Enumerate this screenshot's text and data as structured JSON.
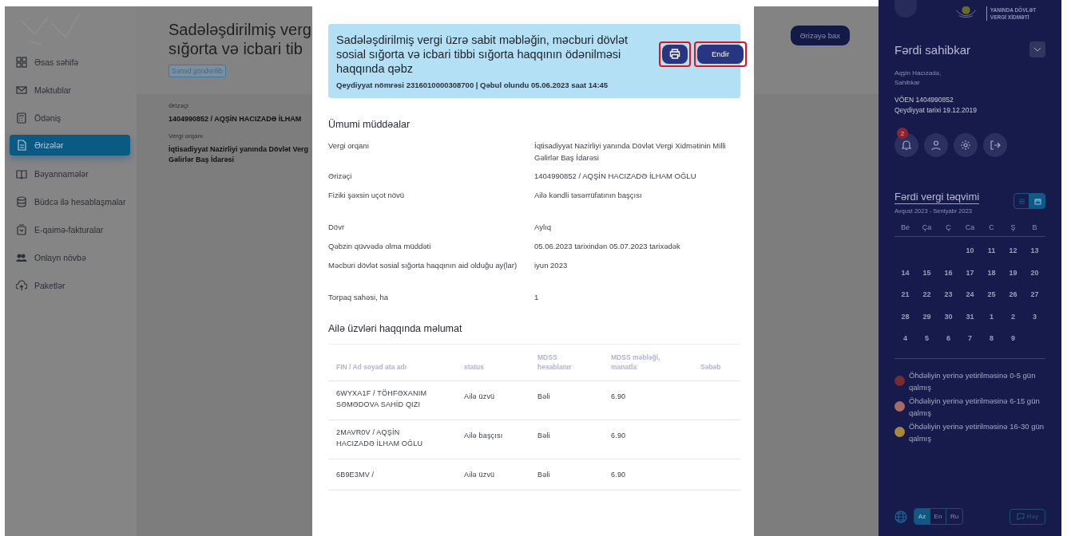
{
  "sidebar": {
    "items": [
      {
        "label": "Əsas səhifə",
        "selected": false
      },
      {
        "label": "Məktublar",
        "selected": false
      },
      {
        "label": "Ödəniş",
        "selected": false
      },
      {
        "label": "Ərizələr",
        "selected": true
      },
      {
        "label": "Bəyannamələr",
        "selected": false
      },
      {
        "label": "Büdcə ilə hesablaşmalar",
        "selected": false
      },
      {
        "label": "E-qaimə-fakturalar",
        "selected": false
      },
      {
        "label": "Onlayn növbə",
        "selected": false
      },
      {
        "label": "Paketlər",
        "selected": false
      }
    ]
  },
  "page": {
    "title_lines": [
      "Sadələşdirilmiş verg",
      "sığorta və icbari tib"
    ],
    "status_badge": "Sənəd göndərilib",
    "view_button": "Ərizəyə bax",
    "fields": [
      {
        "label": "Ərizəçi",
        "value": "1404990852 / AQŞİN HACIZADƏ İLHAM"
      },
      {
        "label": "Vergi orqanı",
        "value": "İqtisadiyyat Nazirliyi yanında Dövlət Verg Gəlirlər Baş İdarəsi"
      }
    ]
  },
  "modal": {
    "title": "Sadələşdirilmiş vergi üzrə sabit məbləğin, məcburi dövlət sosial sığorta və icbari tibbi sığorta haqqının ödənilməsi haqqında qəbz",
    "subtitle": "Qeydiyyat nömrəsi 2316010000308700 | Qəbul olundu 05.06.2023 saat 14:45",
    "print_button": {
      "highlighted": true
    },
    "download_button": {
      "label": "Endir",
      "highlighted": true
    },
    "section_title": "Ümumi müddəalar",
    "details": [
      {
        "label": "Vergi orqanı",
        "value": "İqtisadiyyat Nazirliyi yanında Dövlət Vergi Xidmətinin Milli Gəlirlər Baş İdarəsi"
      },
      {
        "label": "Ərizəçi",
        "value": "1404990852 / AQŞİN HACIZADƏ İLHAM OĞLU"
      },
      {
        "label": "Fiziki şəxsin uçot növü",
        "value": "Ailə kəndli təsərrüfatının başçısı"
      },
      {
        "label": "Dövr",
        "value": "Aylıq"
      },
      {
        "label": "Qəbzin qüvvədə olma müddəti",
        "value": "05.06.2023 tarixindən 05.07.2023 tarixədək"
      },
      {
        "label": "Məcburi dövlət sosial sığorta haqqının aid olduğu ay(lar)",
        "value": "iyun 2023"
      },
      {
        "label": "Torpaq sahəsi, ha",
        "value": "1"
      }
    ],
    "table_title": "Ailə üzvləri haqqında məlumat",
    "table": {
      "columns": [
        "FIN / Ad soyad ata adı",
        "status",
        "MDSS hesablanır",
        "MDSS məbləği, manatla",
        "Səbəb"
      ],
      "rows": [
        [
          "6WYXA1F / TÖHFƏXANIM SƏMƏDOVA SAHİD QIZI",
          "Ailə üzvü",
          "Bəli",
          "6.90"
        ],
        [
          "2MAVR0V / AQŞİN HACIZADƏ İLHAM OĞLU",
          "Ailə başçısı",
          "Bəli",
          "6.90"
        ],
        [
          "6B9E3MV /",
          "Ailə üzvü",
          "Bəli",
          "6.90"
        ]
      ]
    }
  },
  "profile": {
    "logo_text": "YANINDA DÖVLƏT VERGİ XİDMƏTİ",
    "role": "Fərdi sahibkar",
    "name_lines": [
      "Aqşin Hacızadə,",
      "Sahibkar"
    ],
    "voen": "VÖEN 1404990852",
    "registered": "Qeydiyyat tarixi 19.12.2019",
    "notification_count": "2"
  },
  "calendar": {
    "title": "Fərdi vergi təqvimi",
    "range": "Avqust 2023 - Sentyabr 2023",
    "views": [
      {
        "kind": "list",
        "selected": false
      },
      {
        "kind": "calendar",
        "selected": true
      }
    ],
    "weekdays": [
      "Be",
      "Ça",
      "Ç",
      "Ca",
      "C",
      "Ş",
      "B"
    ],
    "weeks": [
      [
        "10",
        "11",
        "12",
        "13"
      ],
      [
        "14",
        "15",
        "16",
        "17",
        "18",
        "19",
        "20"
      ],
      [
        "21",
        "22",
        "23",
        "24",
        "25",
        "26",
        "27"
      ],
      [
        "28",
        "29",
        "30",
        "31",
        "1",
        "2",
        "3"
      ],
      [
        "4",
        "5",
        "6",
        "7",
        "8",
        "9"
      ]
    ],
    "legend": [
      {
        "label": "Öhdəliyin yerinə yetirilməsinə 0-5 gün qalmış",
        "color": "#7a2b2e"
      },
      {
        "label": "Öhdəliyin yerinə yetirilməsinə 6-15 gün qalmış",
        "color": "#a86a66"
      },
      {
        "label": "Öhdəliyin yerinə yetirilməsinə 16-30 gün qalmış",
        "color": "#a8893c"
      }
    ]
  },
  "languages": [
    {
      "label": "Az",
      "selected": true
    },
    {
      "label": "En",
      "selected": false
    },
    {
      "label": "Ru",
      "selected": false
    }
  ],
  "feedback_button": "Rəy"
}
